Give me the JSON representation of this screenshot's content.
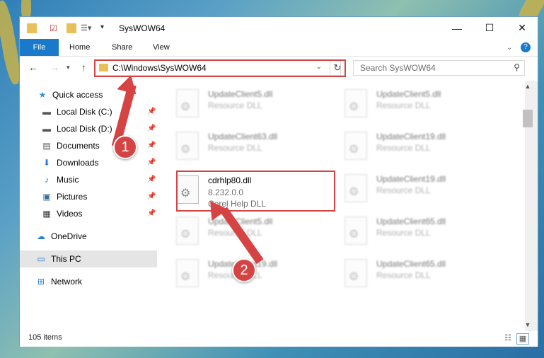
{
  "window": {
    "title": "SysWOW64"
  },
  "ribbon": {
    "file": "File",
    "tabs": [
      "Home",
      "Share",
      "View"
    ]
  },
  "address": {
    "path": "C:\\Windows\\SysWOW64",
    "search_placeholder": "Search SysWOW64"
  },
  "nav": {
    "quick_access": "Quick access",
    "items": [
      "Local Disk (C:)",
      "Local Disk (D:)",
      "Documents",
      "Downloads",
      "Music",
      "Pictures",
      "Videos"
    ],
    "onedrive": "OneDrive",
    "this_pc": "This PC",
    "network": "Network"
  },
  "files": {
    "featured": {
      "name": "cdrhlp80.dll",
      "version": "8.232.0.0",
      "desc": "Corel Help DLL"
    },
    "left_col": [
      {
        "name": "UpdateClient5.dll",
        "desc": "Resource DLL"
      },
      {
        "name": "UpdateClient63.dll",
        "desc": "Resource DLL"
      },
      {
        "name": "UpdateClient5.dll",
        "desc": "Resource DLL"
      },
      {
        "name": "UpdateClient19.dll",
        "desc": "Resource DLL"
      }
    ],
    "right_col": [
      {
        "name": "UpdateClient5.dll",
        "desc": "Resource DLL"
      },
      {
        "name": "UpdateClient19.dll",
        "desc": "Resource DLL"
      },
      {
        "name": "UpdateClient19.dll",
        "desc": "Resource DLL"
      },
      {
        "name": "UpdateClient65.dll",
        "desc": "Resource DLL"
      },
      {
        "name": "UpdateClient65.dll",
        "desc": "Resource DLL"
      }
    ]
  },
  "status": {
    "items": "105 items"
  },
  "annotations": {
    "step1": "1",
    "step2": "2"
  },
  "colors": {
    "accent": "#1979ca",
    "highlight": "#d64343",
    "selected": "#cce8ff"
  }
}
